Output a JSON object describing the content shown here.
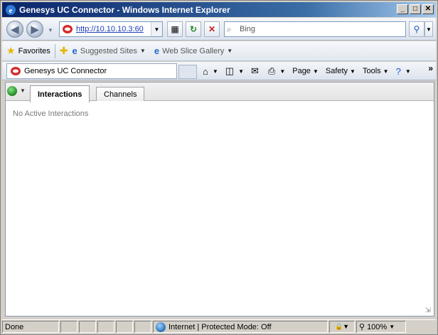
{
  "window": {
    "title": "Genesys UC Connector - Windows Internet Explorer",
    "controls": [
      "_",
      "□",
      "✕"
    ]
  },
  "nav": {
    "url": "http://10.10.10.3:60",
    "search_placeholder": "Bing"
  },
  "favorites_bar": {
    "favorites_label": "Favorites",
    "items": [
      {
        "label": "Suggested Sites"
      },
      {
        "label": "Web Slice Gallery"
      }
    ]
  },
  "command_bar": {
    "tab_label": "Genesys UC Connector",
    "commands": [
      {
        "label": "Page"
      },
      {
        "label": "Safety"
      },
      {
        "label": "Tools"
      }
    ],
    "overflow": "»"
  },
  "app": {
    "tabs": [
      {
        "label": "Interactions",
        "active": true
      },
      {
        "label": "Channels",
        "active": false
      }
    ],
    "empty_message": "No Active Interactions"
  },
  "status_bar": {
    "status": "Done",
    "zone": "Internet | Protected Mode: Off",
    "zoom": "100%"
  },
  "colors": {
    "titlebar": "#0a246a",
    "active_tab_text": "#000000",
    "empty_text": "#7a7a7a"
  }
}
